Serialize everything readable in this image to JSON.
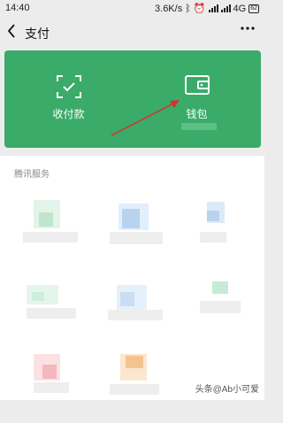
{
  "status_bar": {
    "time": "14:40",
    "speed": "3.6K/s",
    "network": "4G",
    "battery": "62"
  },
  "nav": {
    "back_icon": "chevron-left-icon",
    "title": "支付",
    "more_icon": "more-dots-icon"
  },
  "wallet_card": {
    "background": "#3aab69",
    "items": [
      {
        "label": "收付款",
        "icon": "scan-check-icon"
      },
      {
        "label": "钱包",
        "icon": "wallet-icon"
      }
    ],
    "annotation_arrow_color": "#d7322f"
  },
  "services": {
    "section_title": "腾讯服务"
  },
  "watermark": "头条@Ab小可爱"
}
